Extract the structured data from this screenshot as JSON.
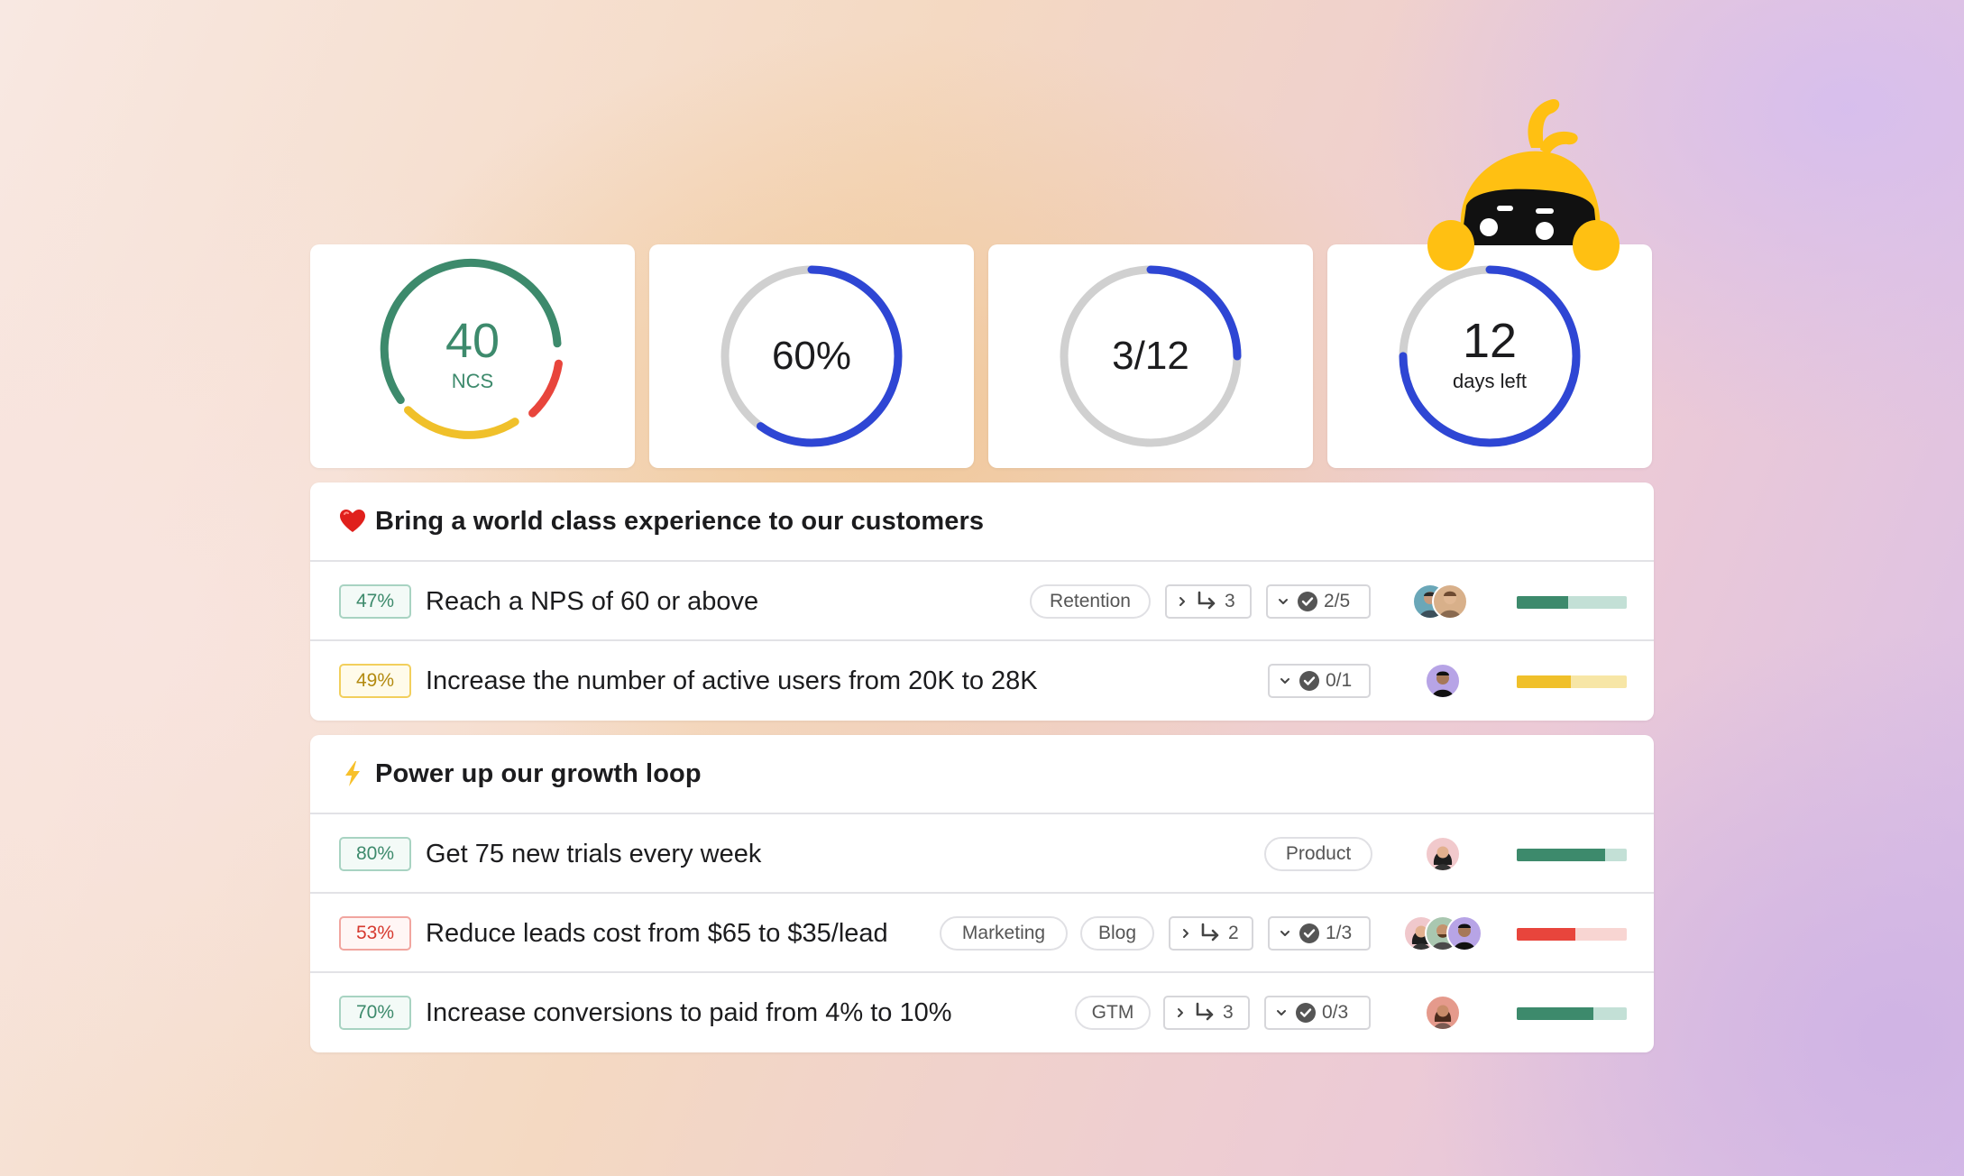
{
  "kpis": {
    "ncs": {
      "value": "40",
      "label": "NCS",
      "color": "#3d8a6c"
    },
    "progress": {
      "value": "60%",
      "fraction": 0.6
    },
    "count": {
      "value": "3/12",
      "fraction": 0.25
    },
    "days": {
      "value": "12",
      "label": "days left",
      "fraction": 0.75
    }
  },
  "colors": {
    "blue": "#2e46d4",
    "ring_gray": "#d0d0d0",
    "green": "#3d8a6c",
    "green_light": "#c3e0d6",
    "yellow": "#f0c02a",
    "yellow_light": "#f7e6a6",
    "red": "#e8453c",
    "red_light": "#f8d5d2",
    "mascot": "#ffc012"
  },
  "objectives": [
    {
      "icon": "heart-icon",
      "title": "Bring a world class experience to our customers",
      "key_results": [
        {
          "percent": "47%",
          "progress": 0.47,
          "status": "green",
          "title": "Reach a NPS of 60 or above",
          "tags": [
            "Retention"
          ],
          "subitems": "3",
          "checks": "2/5",
          "avatars": 2
        },
        {
          "percent": "49%",
          "progress": 0.49,
          "status": "yellow",
          "title": "Increase the number of active users from 20K to 28K",
          "tags": [],
          "subitems": null,
          "checks": "0/1",
          "avatars": 1
        }
      ]
    },
    {
      "icon": "lightning-icon",
      "title": "Power up our growth loop",
      "key_results": [
        {
          "percent": "80%",
          "progress": 0.8,
          "status": "green",
          "title": "Get 75 new trials every week",
          "tags": [
            "Product"
          ],
          "subitems": null,
          "checks": null,
          "avatars": 1
        },
        {
          "percent": "53%",
          "progress": 0.53,
          "status": "red",
          "title": "Reduce leads cost from $65 to $35/lead",
          "tags": [
            "Marketing",
            "Blog"
          ],
          "subitems": "2",
          "checks": "1/3",
          "avatars": 3
        },
        {
          "percent": "70%",
          "progress": 0.7,
          "status": "green",
          "title": "Increase conversions to paid from 4% to 10%",
          "tags": [
            "GTM"
          ],
          "subitems": "3",
          "checks": "0/3",
          "avatars": 1
        }
      ]
    }
  ]
}
